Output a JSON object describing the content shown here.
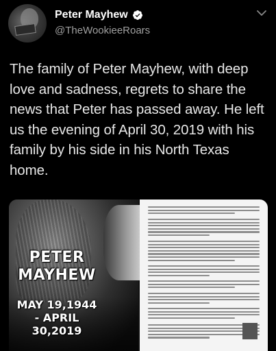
{
  "account": {
    "display_name": "Peter Mayhew",
    "handle": "@TheWookieeRoars",
    "verified": true,
    "avatar_icon": "avatar-photo"
  },
  "tweet": {
    "text": "The family of Peter Mayhew, with deep love and sadness, regrets to share the news that Peter has passed away.  He left us the evening of April 30, 2019 with his family by his side in his North Texas home."
  },
  "media": {
    "photo": {
      "name_first": "PETER",
      "name_last": "MAYHEW",
      "date_birth": "MAY 19,1944",
      "date_death": "- APRIL 30,2019"
    },
    "document": {
      "description_icon": "statement-document"
    }
  },
  "colors": {
    "background": "#000000",
    "text": "#e8e8e8",
    "secondary_text": "#a0a0a0",
    "verified": "#1da1f2"
  }
}
